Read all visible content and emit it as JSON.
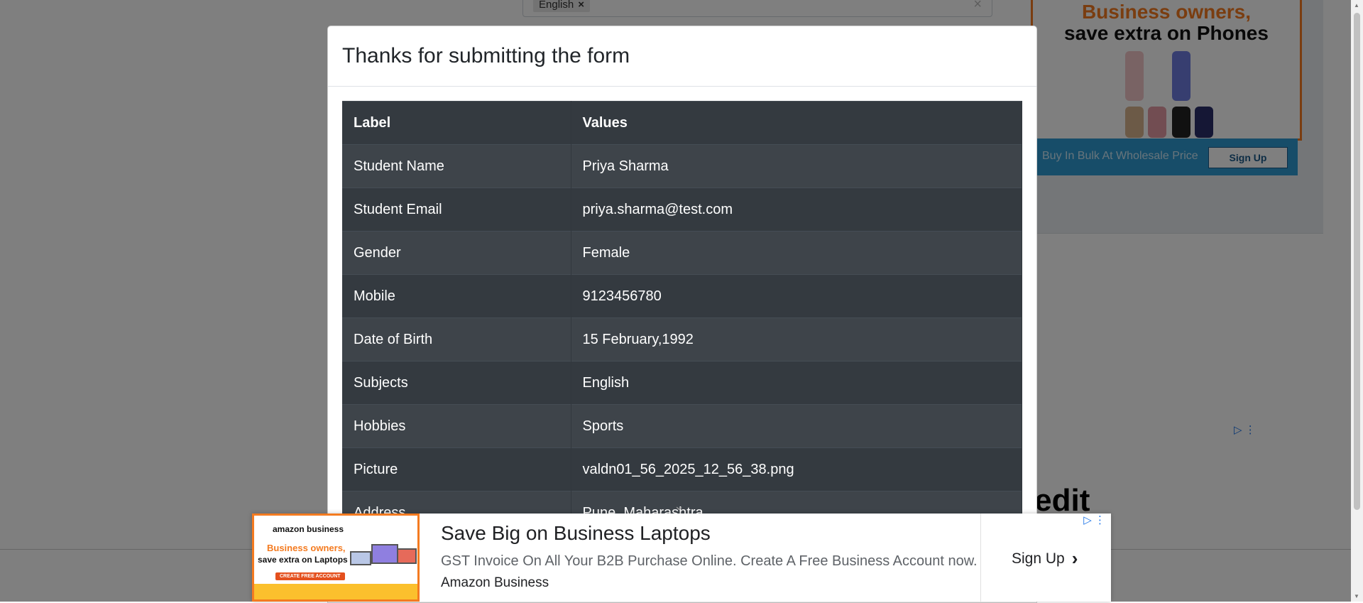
{
  "background": {
    "subjects_chip": "English",
    "chip_remove": "×",
    "clear_icon": "×",
    "right_ad": {
      "title_line1": "Business owners,",
      "title_line2": "save extra on Phones",
      "bar_text": "Buy In Bulk At Wholesale Price",
      "button": "Sign Up"
    },
    "credit_fragment": "redit"
  },
  "modal": {
    "title": "Thanks for submitting the form",
    "table": {
      "headers": [
        "Label",
        "Values"
      ],
      "rows": [
        {
          "label": "Student Name",
          "value": "Priya Sharma"
        },
        {
          "label": "Student Email",
          "value": "priya.sharma@test.com"
        },
        {
          "label": "Gender",
          "value": "Female"
        },
        {
          "label": "Mobile",
          "value": "9123456780"
        },
        {
          "label": "Date of Birth",
          "value": "15 February,1992"
        },
        {
          "label": "Subjects",
          "value": "English"
        },
        {
          "label": "Hobbies",
          "value": "Sports"
        },
        {
          "label": "Picture",
          "value": "valdn01_56_2025_12_56_38.png"
        },
        {
          "label": "Address",
          "value": "Pune, Maharashtra"
        }
      ]
    }
  },
  "bottom_ad": {
    "thumb_brand": "amazon business",
    "thumb_line1": "Business owners,",
    "thumb_line2": "save extra on Laptops",
    "thumb_cta": "CREATE FREE ACCOUNT",
    "title": "Save Big on Business Laptops",
    "description": "GST Invoice On All Your B2B Purchase Online. Create A Free Business Account now.",
    "advertiser": "Amazon Business",
    "cta": "Sign Up"
  },
  "colors": {
    "table_dark": "#343a40",
    "table_stripe": "#3e444a",
    "ad_orange": "#f47b20",
    "ad_blue": "#2f9bd2"
  }
}
